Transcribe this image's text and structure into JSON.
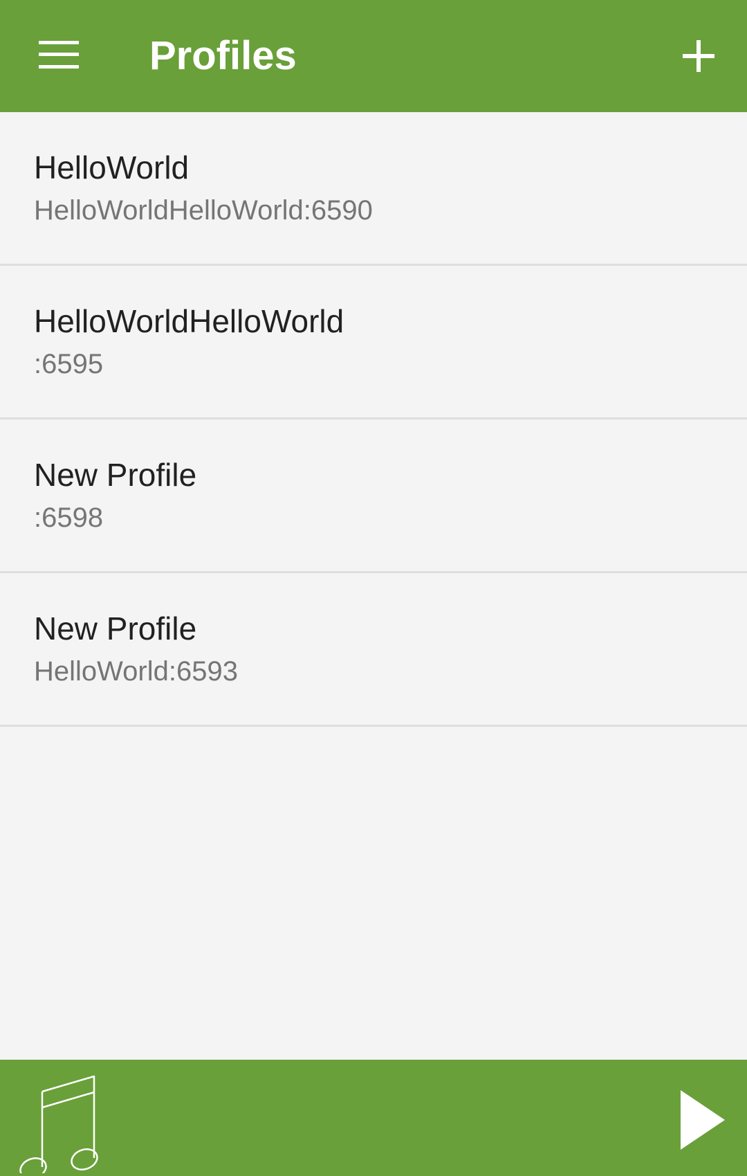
{
  "header": {
    "title": "Profiles",
    "menu_icon": "hamburger-menu-icon",
    "add_icon": "plus-icon"
  },
  "profiles": [
    {
      "name": "HelloWorld",
      "detail": "HelloWorldHelloWorld:6590"
    },
    {
      "name": "HelloWorldHelloWorld",
      "detail": ":6595"
    },
    {
      "name": "New Profile",
      "detail": ":6598"
    },
    {
      "name": "New Profile",
      "detail": "HelloWorld:6593"
    }
  ],
  "bottom_bar": {
    "music_icon": "music-note-icon",
    "play_icon": "play-icon"
  },
  "colors": {
    "accent": "#69a039",
    "background": "#f4f4f4",
    "divider": "#dedede",
    "primary_text": "#212121",
    "secondary_text": "#757575"
  }
}
